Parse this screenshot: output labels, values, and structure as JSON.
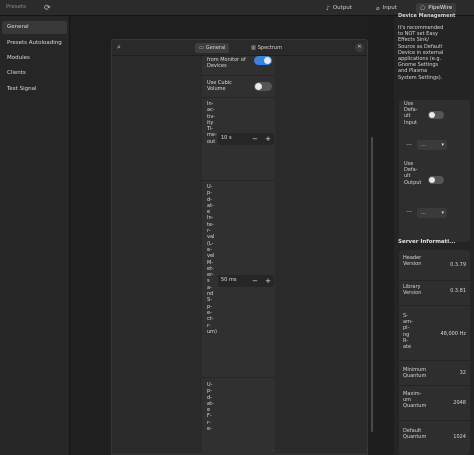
{
  "header": {
    "presets_label": "Presets",
    "reload_icon": "reload-icon",
    "tabs": [
      {
        "label": "Output",
        "icon": "speaker-icon"
      },
      {
        "label": "Input",
        "icon": "microphone-icon"
      },
      {
        "label": "PipeWire",
        "icon": "pipewire-icon"
      }
    ]
  },
  "sidebar": {
    "items": [
      {
        "label": "General"
      },
      {
        "label": "Presets Autoloading"
      },
      {
        "label": "Modules"
      },
      {
        "label": "Clients"
      },
      {
        "label": "Test Signal"
      }
    ]
  },
  "dialog": {
    "tabs": [
      {
        "label": "General",
        "icon": "settings-icon"
      },
      {
        "label": "Spectrum",
        "icon": "spectrum-icon"
      }
    ],
    "rows": {
      "monitor_label": "from Monitor of\nDevices",
      "cubic_label": "Use Cubic\nVolume",
      "timeout_label": "In-\nac-\ntiv-\nity\nTi-\nme-\nout",
      "timeout_value": "10 s",
      "interval_label": "U-\np-\nd-\nat-\ne\nIn-\nte-\nr-\nval\n(L-\ne-\nvel\nM-\net-\ner-\ns\na-\nnd\nS-\np-\ne-\nct-\nr-\num)",
      "interval_value": "50 ms",
      "freq_label": "U-\np-\nd-\nat-\ne\nF-\nr-\ne-"
    },
    "spin_minus": "−",
    "spin_plus": "+"
  },
  "rpanel": {
    "header_text": "Device Management",
    "info_text": "It's recommended\nto NOT set Easy\nEffects Sink/\nSource as Default\nDevice in external\napplications (e.g.\nGnome Settings\nand Plasma\nSystem Settings).",
    "use_default_input": "Use\nDefa-\nult\nInput",
    "use_default_output": "Use\nDefa-\nult\nOutput",
    "device_dash": "—",
    "device_value": "...",
    "server_title": "Server Informati...",
    "server_rows": [
      {
        "key": "Header\nVersion",
        "value": "0.3.79"
      },
      {
        "key": "Library\nVersion",
        "value": "0.3.81"
      },
      {
        "key": "S-\nam-\npl-\nng\nR-\nate",
        "value": "48,000 Hz"
      },
      {
        "key": "Minimum\nQuantum",
        "value": "32"
      },
      {
        "key": "Maxim-\num\nQuantum",
        "value": "2048"
      },
      {
        "key": "Default\nQuantum",
        "value": "1024"
      }
    ]
  }
}
